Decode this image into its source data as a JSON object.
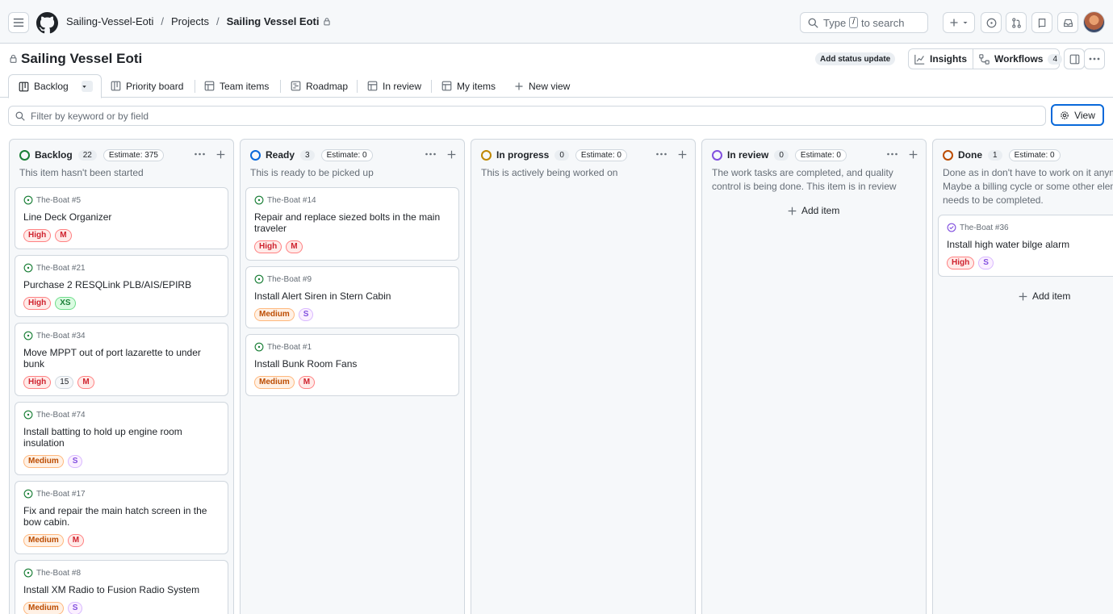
{
  "breadcrumb": {
    "org": "Sailing-Vessel-Eoti",
    "projects": "Projects",
    "project": "Sailing Vessel Eoti",
    "sep": "/"
  },
  "search": {
    "prefix": "Type",
    "key": "/",
    "suffix": "to search"
  },
  "project": {
    "title": "Sailing Vessel Eoti",
    "status_update": "Add status update",
    "insights": "Insights",
    "workflows": "Workflows",
    "workflows_count": "4"
  },
  "tabs": [
    {
      "label": "Backlog",
      "icon": "board-icon"
    },
    {
      "label": "Priority board",
      "icon": "board-icon"
    },
    {
      "label": "Team items",
      "icon": "table-icon"
    },
    {
      "label": "Roadmap",
      "icon": "roadmap-icon"
    },
    {
      "label": "In review",
      "icon": "table-icon"
    },
    {
      "label": "My items",
      "icon": "table-icon"
    },
    {
      "label": "New view",
      "icon": "plus-icon"
    }
  ],
  "filter": {
    "placeholder": "Filter by keyword or by field",
    "view_label": "View"
  },
  "add_item_label": "Add item",
  "columns": [
    {
      "name": "Backlog",
      "count": "22",
      "estimate": "Estimate: 375",
      "color": "#1a7f37",
      "description": "This item hasn't been started",
      "cards": [
        {
          "ref": "The-Boat #5",
          "title": "Line Deck Organizer",
          "tags": [
            "High",
            "M"
          ]
        },
        {
          "ref": "The-Boat #21",
          "title": "Purchase 2 RESQLink PLB/AIS/EPIRB",
          "tags": [
            "High",
            "XS"
          ]
        },
        {
          "ref": "The-Boat #34",
          "title": "Move MPPT out of port lazarette to under bunk",
          "tags": [
            "High",
            "15",
            "M"
          ]
        },
        {
          "ref": "The-Boat #74",
          "title": "Install batting to hold up engine room insulation",
          "tags": [
            "Medium",
            "S"
          ]
        },
        {
          "ref": "The-Boat #17",
          "title": "Fix and repair the main hatch screen in the bow cabin.",
          "tags": [
            "Medium",
            "M"
          ]
        },
        {
          "ref": "The-Boat #8",
          "title": "Install XM Radio to Fusion Radio System",
          "tags": [
            "Medium",
            "S"
          ]
        }
      ]
    },
    {
      "name": "Ready",
      "count": "3",
      "estimate": "Estimate: 0",
      "color": "#0969da",
      "description": "This is ready to be picked up",
      "cards": [
        {
          "ref": "The-Boat #14",
          "title": "Repair and replace siezed bolts in the main traveler",
          "tags": [
            "High",
            "M"
          ]
        },
        {
          "ref": "The-Boat #9",
          "title": "Install Alert Siren in Stern Cabin",
          "tags": [
            "Medium",
            "S"
          ]
        },
        {
          "ref": "The-Boat #1",
          "title": "Install Bunk Room Fans",
          "tags": [
            "Medium",
            "M"
          ]
        }
      ]
    },
    {
      "name": "In progress",
      "count": "0",
      "estimate": "Estimate: 0",
      "color": "#bf8700",
      "description": "This is actively being worked on",
      "cards": []
    },
    {
      "name": "In review",
      "count": "0",
      "estimate": "Estimate: 0",
      "color": "#8250df",
      "description": "The work tasks are completed, and quality control is being done. This item is in review",
      "cards": []
    },
    {
      "name": "Done",
      "count": "1",
      "estimate": "Estimate: 0",
      "color": "#bc4c00",
      "description": "Done as in don't have to work on it anymore. Maybe a billing cycle or some other element needs to be completed.",
      "cards": [
        {
          "ref": "The-Boat #36",
          "title": "Install high water bilge alarm",
          "tags": [
            "High",
            "S"
          ],
          "closed": true
        }
      ]
    }
  ]
}
